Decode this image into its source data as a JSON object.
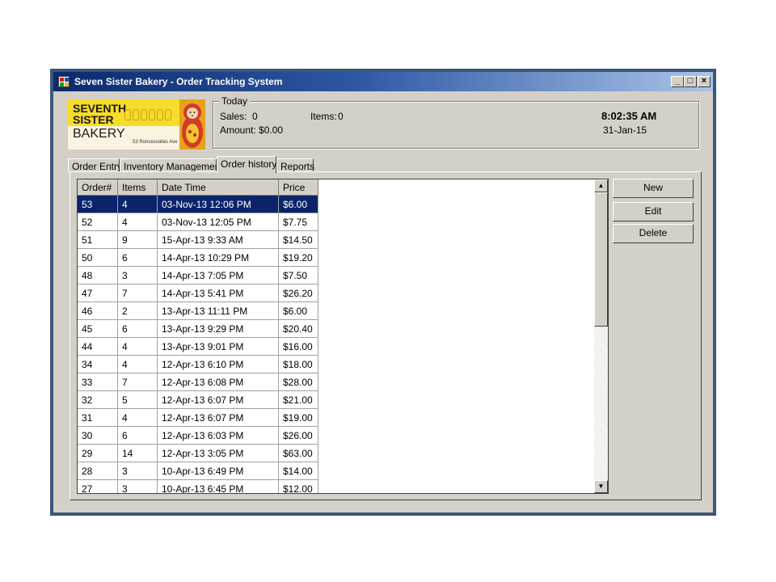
{
  "window": {
    "title": "Seven Sister Bakery - Order Tracking System"
  },
  "logo": {
    "line1": "SEVENTH",
    "line2": "SISTER",
    "line3": "BAKERY",
    "address": "53 Roncesvalles Ave"
  },
  "today": {
    "legend": "Today",
    "sales_label": "Sales:",
    "sales_value": "0",
    "items_label": "Items:",
    "items_value": "0",
    "amount_label": "Amount: $0.00",
    "time": "8:02:35 AM",
    "date": "31-Jan-15"
  },
  "tabs": [
    "Order Entry",
    "Inventory Management",
    "Order history",
    "Reports"
  ],
  "active_tab": "Order history",
  "grid": {
    "columns": [
      "Order#",
      "Items",
      "Date Time",
      "Price"
    ],
    "rows": [
      [
        "53",
        "4",
        "03-Nov-13 12:06 PM",
        "$6.00"
      ],
      [
        "52",
        "4",
        "03-Nov-13 12:05 PM",
        "$7.75"
      ],
      [
        "51",
        "9",
        "15-Apr-13 9:33 AM",
        "$14.50"
      ],
      [
        "50",
        "6",
        "14-Apr-13 10:29 PM",
        "$19.20"
      ],
      [
        "48",
        "3",
        "14-Apr-13 7:05 PM",
        "$7.50"
      ],
      [
        "47",
        "7",
        "14-Apr-13 5:41 PM",
        "$26.20"
      ],
      [
        "46",
        "2",
        "13-Apr-13 11:11 PM",
        "$6.00"
      ],
      [
        "45",
        "6",
        "13-Apr-13 9:29 PM",
        "$20.40"
      ],
      [
        "44",
        "4",
        "13-Apr-13 9:01 PM",
        "$16.00"
      ],
      [
        "34",
        "4",
        "12-Apr-13 6:10 PM",
        "$18.00"
      ],
      [
        "33",
        "7",
        "12-Apr-13 6:08 PM",
        "$28.00"
      ],
      [
        "32",
        "5",
        "12-Apr-13 6:07 PM",
        "$21.00"
      ],
      [
        "31",
        "4",
        "12-Apr-13 6:07 PM",
        "$19.00"
      ],
      [
        "30",
        "6",
        "12-Apr-13 6:03 PM",
        "$26.00"
      ],
      [
        "29",
        "14",
        "12-Apr-13 3:05 PM",
        "$63.00"
      ],
      [
        "28",
        "3",
        "10-Apr-13 6:49 PM",
        "$14.00"
      ],
      [
        "27",
        "3",
        "10-Apr-13 6:45 PM",
        "$12.00"
      ]
    ]
  },
  "buttons": {
    "new": "New",
    "edit": "Edit",
    "delete": "Delete"
  },
  "colors": {
    "selection": "#0a246a",
    "window_face": "#d4d0c8",
    "title_start": "#0b2a6b",
    "title_end": "#a9c4e8"
  }
}
